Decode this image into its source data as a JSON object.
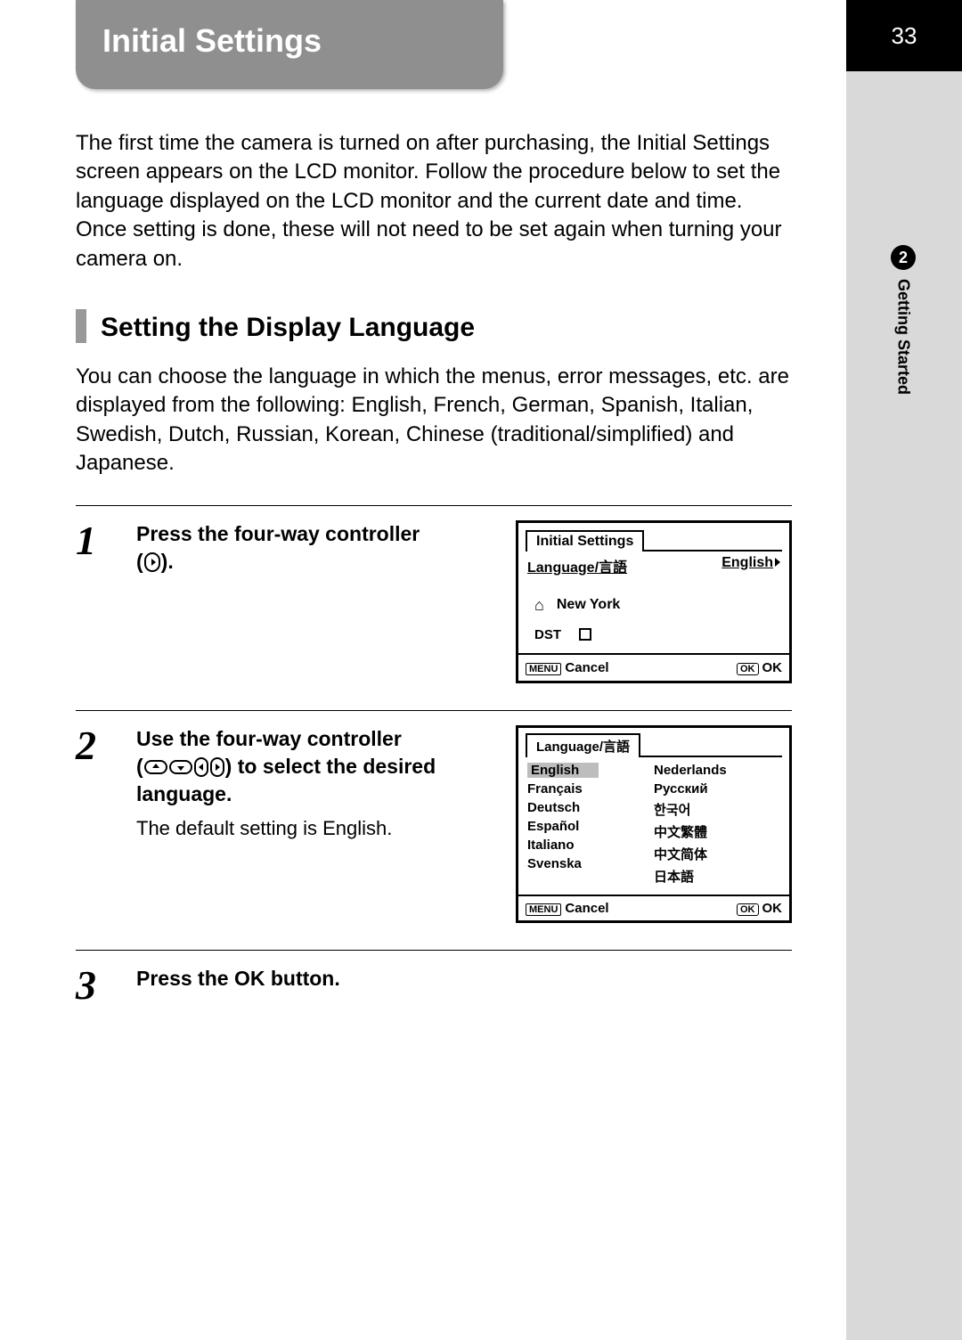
{
  "page_number": "33",
  "chapter": {
    "number": "2",
    "title": "Getting Started"
  },
  "title": "Initial Settings",
  "intro": "The first time the camera is turned on after purchasing, the Initial Settings screen appears on the LCD monitor. Follow the procedure below to set the language displayed on the LCD monitor and the current date and time. Once setting is done, these will not need to be set again when turning your camera on.",
  "section": {
    "heading": "Setting the Display Language",
    "text": "You can choose the language in which the menus, error messages, etc. are displayed from the following: English, French, German, Spanish, Italian, Swedish, Dutch, Russian, Korean, Chinese (traditional/simplified) and Japanese."
  },
  "steps": {
    "s1": {
      "num": "1",
      "instr_a": "Press the four-way controller ",
      "instr_b": "(",
      "instr_c": ")."
    },
    "s2": {
      "num": "2",
      "instr_a": "Use the four-way controller ",
      "instr_b": "(",
      "instr_c": ") to select the desired language.",
      "sub": "The default setting is English."
    },
    "s3": {
      "num": "3",
      "instr_a": "Press the ",
      "instr_ok": "OK",
      "instr_b": " button."
    }
  },
  "screen1": {
    "title": "Initial Settings",
    "lang_label": "Language/言語",
    "lang_value": "English",
    "city": "New York",
    "dst_label": "DST",
    "menu_label": "MENU",
    "cancel": "Cancel",
    "ok_label": "OK",
    "ok_text": "OK"
  },
  "screen2": {
    "title": "Language/言語",
    "col1": [
      "English",
      "Français",
      "Deutsch",
      "Español",
      "Italiano",
      "Svenska"
    ],
    "col2": [
      "Nederlands",
      "Русский",
      "한국어",
      "中文繁體",
      "中文简体",
      "日本語"
    ],
    "menu_label": "MENU",
    "cancel": "Cancel",
    "ok_label": "OK",
    "ok_text": "OK"
  }
}
